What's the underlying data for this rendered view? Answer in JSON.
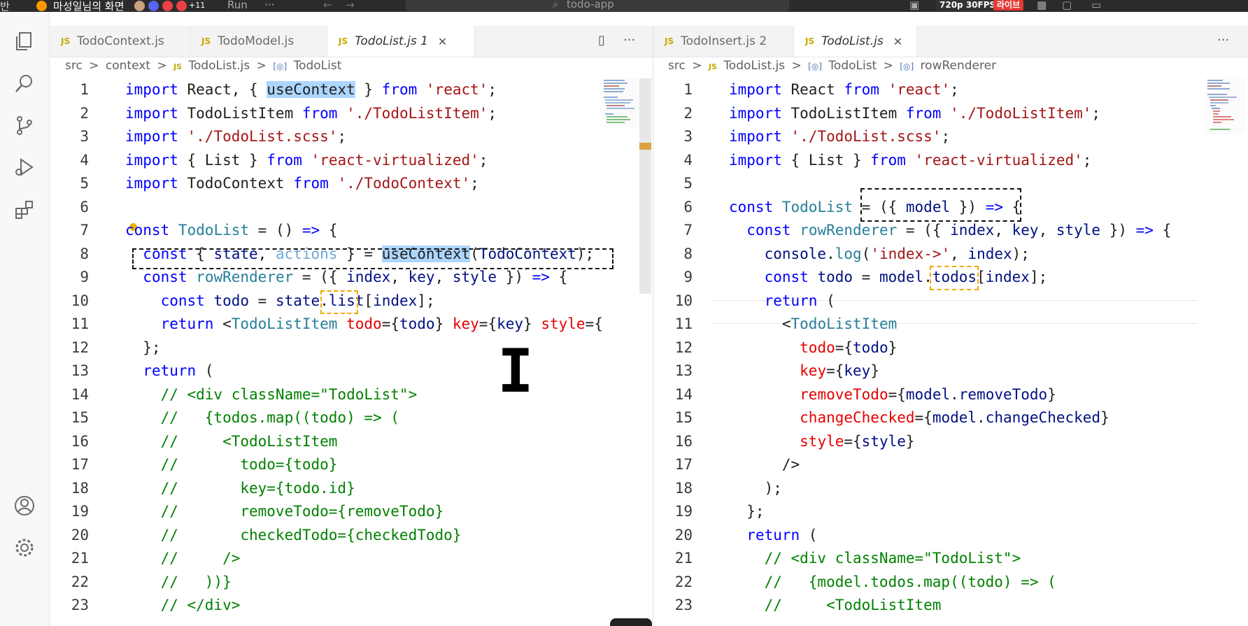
{
  "topbar": {
    "left_fragment": "반",
    "stream_title": "마성일님의 화면",
    "viewer_extra": "+11",
    "run_label": "Run",
    "more": "···",
    "search_text": "todo-app",
    "quality": "720p 30FPS",
    "live": "라이브",
    "colors": {
      "discord": "#5865f2",
      "live": "#e53935",
      "badge": "#222222"
    }
  },
  "activity_bar": [
    "files-icon",
    "search-icon",
    "source-control-icon",
    "run-debug-icon",
    "extensions-icon",
    "account-icon",
    "settings-gear-icon"
  ],
  "left_group": {
    "tabs": [
      {
        "label": "TodoContext.js",
        "active": false,
        "italic": false
      },
      {
        "label": "TodoModel.js",
        "active": false,
        "italic": false
      },
      {
        "label": "TodoList.js 1",
        "active": true,
        "italic": true
      }
    ],
    "close_glyph": "✕",
    "split_glyph": "▯",
    "more_glyph": "···",
    "breadcrumb": {
      "folder1": "src",
      "folder2": "context",
      "file": "TodoList.js",
      "symbol": "TodoList",
      "sep": ">",
      "js": "JS",
      "sym_icon": "[◎]"
    }
  },
  "right_group": {
    "tabs": [
      {
        "label": "TodoInsert.js 2",
        "active": false,
        "italic": false
      },
      {
        "label": "TodoList.js",
        "active": true,
        "italic": true
      }
    ],
    "close_glyph": "✕",
    "more_glyph": "···",
    "breadcrumb": {
      "folder1": "src",
      "file": "TodoList.js",
      "symbol": "TodoList",
      "symbol2": "rowRenderer",
      "sep": ">",
      "js": "JS",
      "sym_icon": "[◎]"
    }
  },
  "left_code": [
    "import React, { useContext } from 'react';",
    "import TodoListItem from './TodoListItem';",
    "import './TodoList.scss';",
    "import { List } from 'react-virtualized';",
    "import TodoContext from './TodoContext';",
    "",
    "const TodoList = () => {",
    "  const { state, actions } = useContext(TodoContext);",
    "  const rowRenderer = ({ index, key, style }) => {",
    "    const todo = state.list[index];",
    "    return <TodoListItem todo={todo} key={key} style={",
    "  };",
    "  return (",
    "    // <div className=\"TodoList\">",
    "    //   {todos.map((todo) => (",
    "    //     <TodoListItem",
    "    //       todo={todo}",
    "    //       key={todo.id}",
    "    //       removeTodo={removeTodo}",
    "    //       checkedTodo={checkedTodo}",
    "    //     />",
    "    //   ))}",
    "    // </div>"
  ],
  "right_code": [
    "import React from 'react';",
    "import TodoListItem from './TodoListItem';",
    "import './TodoList.scss';",
    "import { List } from 'react-virtualized';",
    "",
    "const TodoList = ({ model }) => {",
    "  const rowRenderer = ({ index, key, style }) => {",
    "    console.log('index->', index);",
    "    const todo = model.todos[index];",
    "    return (",
    "      <TodoListItem",
    "        todo={todo}",
    "        key={key}",
    "        removeTodo={model.removeTodo}",
    "        changeChecked={model.changeChecked}",
    "        style={style}",
    "      />",
    "    );",
    "  };",
    "  return (",
    "    // <div className=\"TodoList\">",
    "    //   {model.todos.map((todo) => (",
    "    //     <TodoListItem"
  ],
  "cursor_glyph": "I"
}
